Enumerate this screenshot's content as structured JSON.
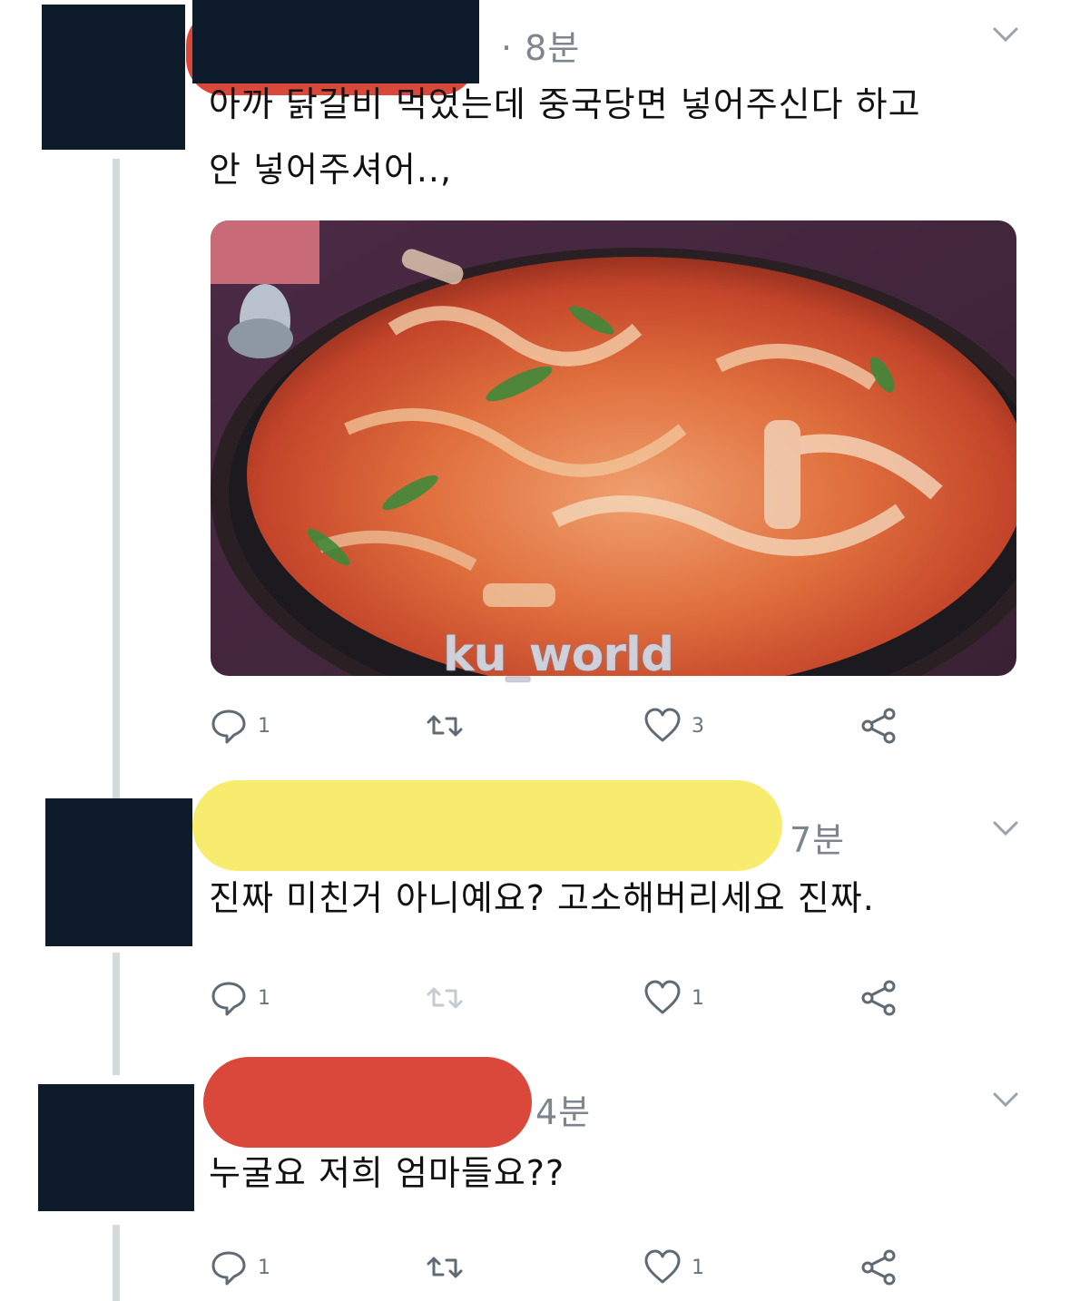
{
  "tweets": [
    {
      "time": "· 8분",
      "text_lines": [
        "아까 닭갈비 먹었는데 중국당면 넣어주신다 하고",
        "안 넣어주셔어..,"
      ],
      "reply_count": "1",
      "retweet_count": "",
      "like_count": "3",
      "image_watermark": "ku_world"
    },
    {
      "time": "7분",
      "text_lines": [
        "진짜 미친거 아니예요? 고소해버리세요 진짜."
      ],
      "reply_count": "1",
      "retweet_count": "",
      "like_count": "1"
    },
    {
      "time": "4분",
      "text_lines": [
        "누굴요 저희 엄마들요??"
      ],
      "reply_count": "1",
      "retweet_count": "",
      "like_count": "1"
    }
  ],
  "icons": [
    "reply-icon",
    "retweet-icon",
    "like-icon",
    "share-icon",
    "chevron-down-icon"
  ],
  "colors": {
    "redaction_red": "#d9483b",
    "redaction_yellow": "#f7ec6e",
    "avatar_block": "#0d1b2a",
    "muted": "#7d868e"
  }
}
